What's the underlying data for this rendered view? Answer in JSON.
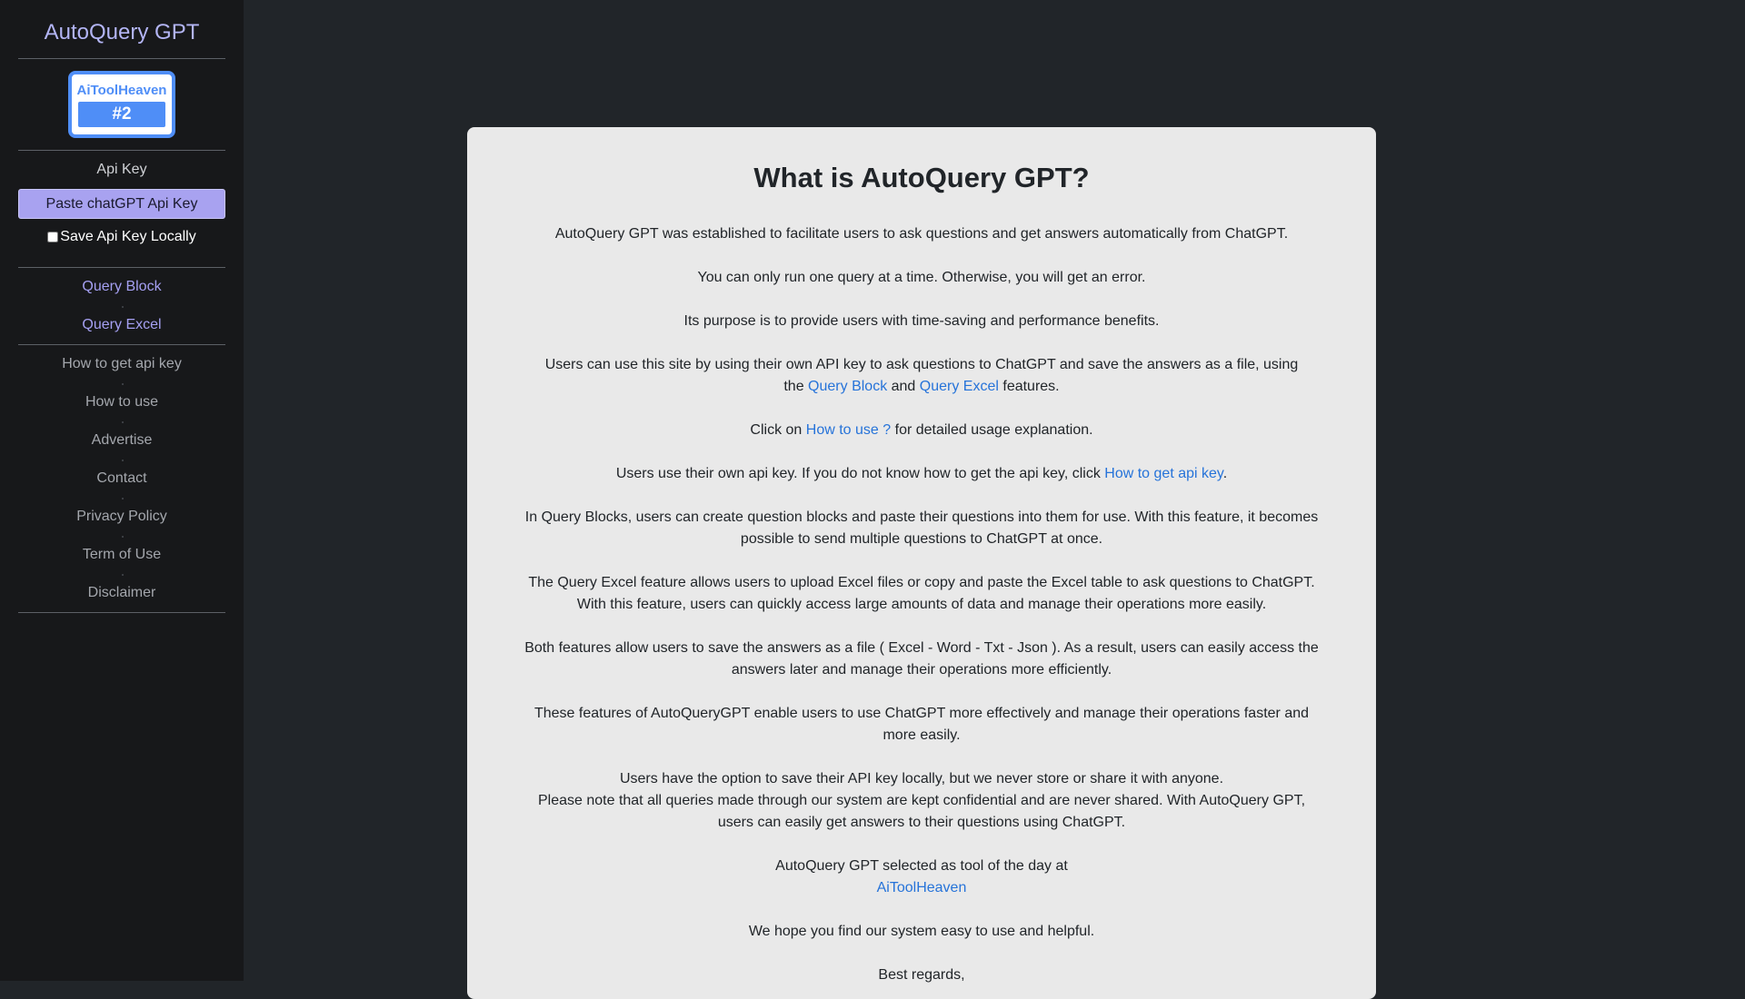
{
  "sidebar": {
    "app_title": "AutoQuery GPT",
    "badge": {
      "name": "AiToolHeaven",
      "rank": "#2"
    },
    "api_label": "Api Key",
    "api_placeholder": "Paste chatGPT Api Key",
    "save_label": "Save Api Key Locally",
    "save_checked": false,
    "primary_nav": [
      "Query Block",
      "Query Excel"
    ],
    "secondary_nav": [
      "How to get api key",
      "How to use",
      "Advertise",
      "Contact",
      "Privacy Policy",
      "Term of Use",
      "Disclaimer"
    ]
  },
  "main": {
    "title": "What is AutoQuery GPT?",
    "p1": "AutoQuery GPT was established to facilitate users to ask questions and get answers automatically from ChatGPT.",
    "p2": "You can only run one query at a time. Otherwise, you will get an error.",
    "p3": "Its purpose is to provide users with time-saving and performance benefits.",
    "p4": {
      "pre": "Users can use this site by using their own API key to ask questions to ChatGPT and save the answers as a file, using the ",
      "link1": "Query Block",
      "mid": " and ",
      "link2": "Query Excel",
      "post": " features."
    },
    "p5": {
      "pre": "Click on ",
      "link": "How to use ?",
      "post": " for detailed usage explanation."
    },
    "p6": {
      "pre": "Users use their own api key. If you do not know how to get the api key, click ",
      "link": "How to get api key",
      "post": "."
    },
    "p7": "In Query Blocks, users can create question blocks and paste their questions into them for use. With this feature, it becomes possible to send multiple questions to ChatGPT at once.",
    "p8": "The Query Excel feature allows users to upload Excel files or copy and paste the Excel table to ask questions to ChatGPT. With this feature, users can quickly access large amounts of data and manage their operations more easily.",
    "p9": "Both features allow users to save the answers as a file ( Excel - Word - Txt - Json ). As a result, users can easily access the answers later and manage their operations more efficiently.",
    "p10": "These features of AutoQueryGPT enable users to use ChatGPT more effectively and manage their operations faster and more easily.",
    "p11_line1": "Users have the option to save their API key locally, but we never store or share it with anyone.",
    "p11_line2": "Please note that all queries made through our system are kept confidential and are never shared. With AutoQuery GPT, users can easily get answers to their questions using ChatGPT.",
    "p12_line1": "AutoQuery GPT selected as tool of the day at",
    "p12_link": "AiToolHeaven",
    "p13": "We hope you find our system easy to use and helpful.",
    "p14": "Best regards,"
  }
}
